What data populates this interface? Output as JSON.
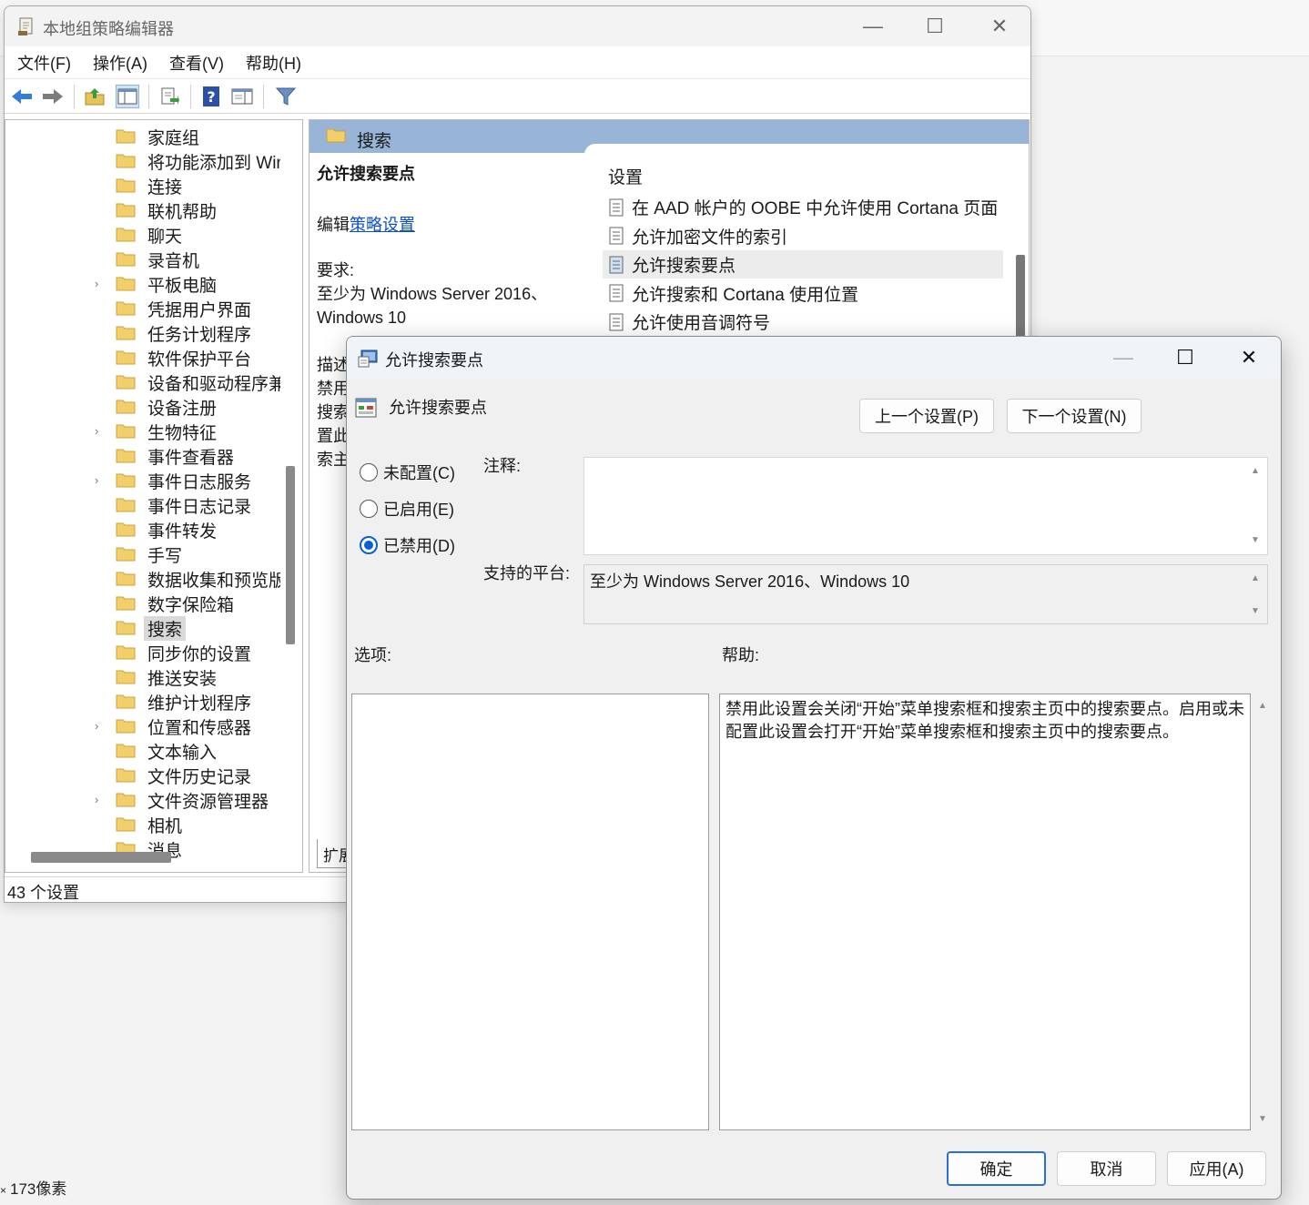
{
  "background": {
    "status_text": "173像素"
  },
  "main_window": {
    "title": "本地组策略编辑器",
    "menu": [
      "文件(F)",
      "操作(A)",
      "查看(V)",
      "帮助(H)"
    ],
    "tree": [
      {
        "label": "家庭组",
        "expandable": false
      },
      {
        "label": "将功能添加到 Win",
        "expandable": false
      },
      {
        "label": "连接",
        "expandable": false
      },
      {
        "label": "联机帮助",
        "expandable": false
      },
      {
        "label": "聊天",
        "expandable": false
      },
      {
        "label": "录音机",
        "expandable": false
      },
      {
        "label": "平板电脑",
        "expandable": true
      },
      {
        "label": "凭据用户界面",
        "expandable": false
      },
      {
        "label": "任务计划程序",
        "expandable": false
      },
      {
        "label": "软件保护平台",
        "expandable": false
      },
      {
        "label": "设备和驱动程序兼",
        "expandable": false
      },
      {
        "label": "设备注册",
        "expandable": false
      },
      {
        "label": "生物特征",
        "expandable": true
      },
      {
        "label": "事件查看器",
        "expandable": false
      },
      {
        "label": "事件日志服务",
        "expandable": true
      },
      {
        "label": "事件日志记录",
        "expandable": false
      },
      {
        "label": "事件转发",
        "expandable": false
      },
      {
        "label": "手写",
        "expandable": false
      },
      {
        "label": "数据收集和预览版",
        "expandable": false
      },
      {
        "label": "数字保险箱",
        "expandable": false
      },
      {
        "label": "搜索",
        "expandable": false,
        "selected": true
      },
      {
        "label": "同步你的设置",
        "expandable": false
      },
      {
        "label": "推送安装",
        "expandable": false
      },
      {
        "label": "维护计划程序",
        "expandable": false
      },
      {
        "label": "位置和传感器",
        "expandable": true
      },
      {
        "label": "文本输入",
        "expandable": false
      },
      {
        "label": "文件历史记录",
        "expandable": false
      },
      {
        "label": "文件资源管理器",
        "expandable": true
      },
      {
        "label": "相机",
        "expandable": false
      },
      {
        "label": "消息",
        "expandable": false
      }
    ],
    "right_header": "搜索",
    "desc_title": "允许搜索要点",
    "desc_edit_prefix": "编辑",
    "desc_edit_link": "策略设置",
    "desc_req_label": "要求:",
    "desc_req_line1": "至少为 Windows Server 2016、",
    "desc_req_line2": "Windows 10",
    "desc_fragments": [
      "描述",
      "禁用",
      "搜索",
      "置此",
      "索主"
    ],
    "settings_header": "设置",
    "settings": [
      {
        "label": "在 AAD 帐户的 OOBE 中允许使用 Cortana 页面"
      },
      {
        "label": "允许加密文件的索引"
      },
      {
        "label": "允许搜索要点",
        "selected": true
      },
      {
        "label": "允许搜索和 Cortana 使用位置"
      },
      {
        "label": "允许使用音调符号"
      }
    ],
    "ext_tab": "扩展",
    "status": "43 个设置"
  },
  "dialog": {
    "title": "允许搜索要点",
    "policy_name": "允许搜索要点",
    "prev_button": "上一个设置(P)",
    "next_button": "下一个设置(N)",
    "radios": [
      {
        "label": "未配置(C)",
        "checked": false
      },
      {
        "label": "已启用(E)",
        "checked": false
      },
      {
        "label": "已禁用(D)",
        "checked": true
      }
    ],
    "comment_label": "注释:",
    "comment_value": "",
    "platform_label": "支持的平台:",
    "platform_value": "至少为 Windows Server 2016、Windows 10",
    "options_label": "选项:",
    "help_label": "帮助:",
    "help_text": "禁用此设置会关闭“开始”菜单搜索框和搜索主页中的搜索要点。启用或未配置此设置会打开“开始”菜单搜索框和搜索主页中的搜索要点。",
    "ok_button": "确定",
    "cancel_button": "取消",
    "apply_button": "应用(A)"
  },
  "colors": {
    "accent": "#0a5fd6",
    "header_blue": "#98b4d6",
    "link": "#0b4fd1",
    "folder": "#f2cf6b"
  }
}
